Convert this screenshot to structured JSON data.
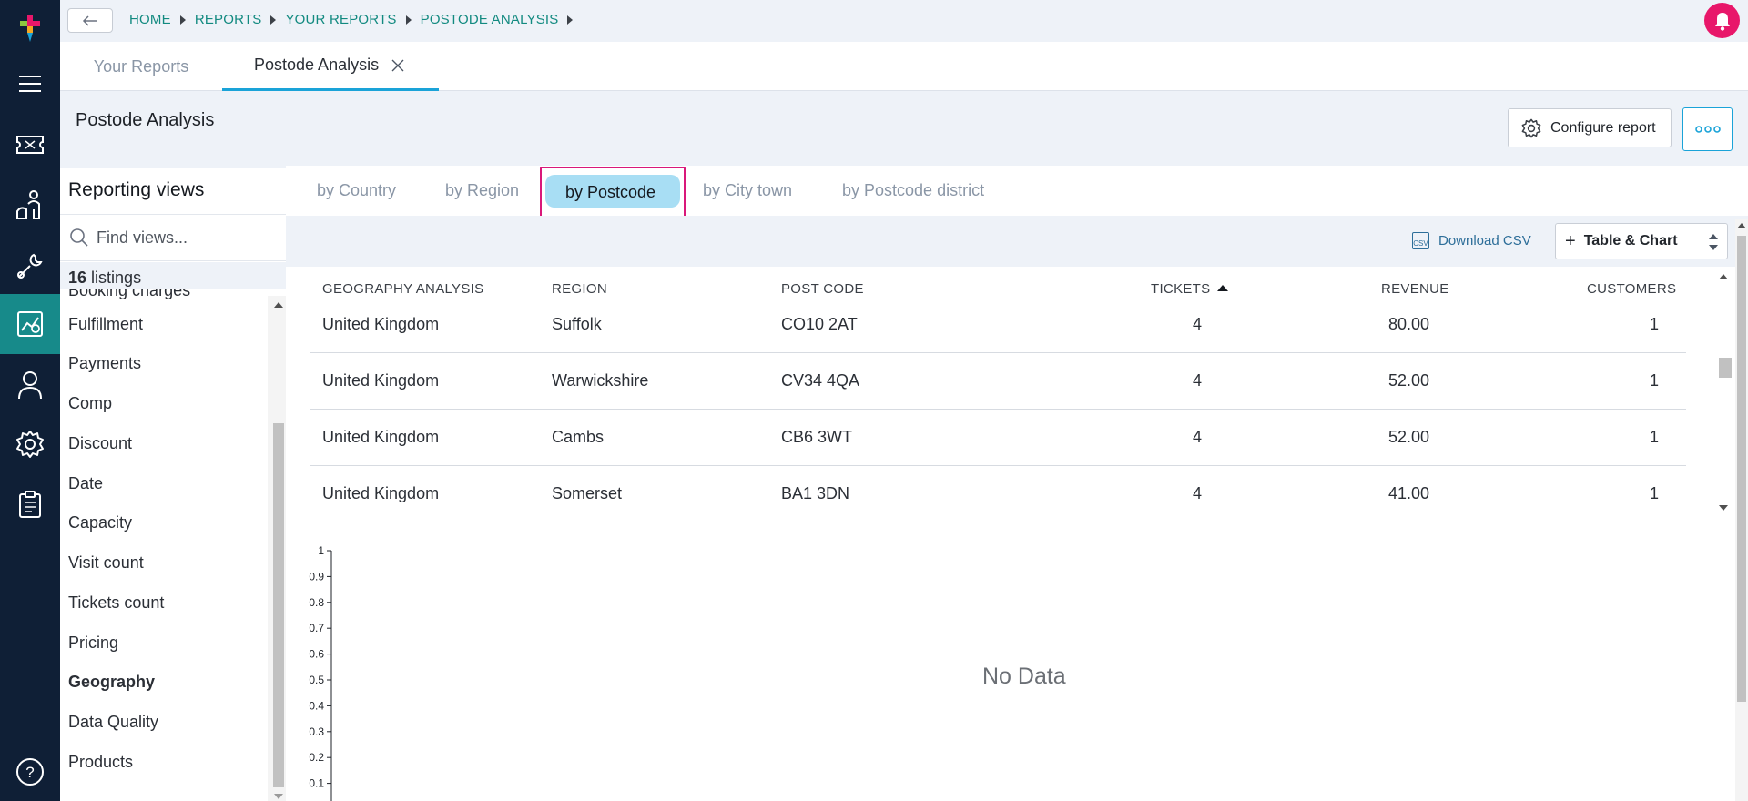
{
  "colors": {
    "rail_bg": "#0f1f36",
    "rail_active": "#178a8a",
    "accent": "#1aa3d8",
    "brand_pink": "#e8176a",
    "breadcrumb": "#128a80",
    "highlight_frame": "#d9187a"
  },
  "rail": {
    "icons": [
      "logo-icon",
      "menu-icon",
      "ticket-icon",
      "users-icon",
      "tools-icon",
      "reports-icon",
      "person-icon",
      "settings-icon",
      "clipboard-icon",
      "help-icon"
    ],
    "active": "reports-icon"
  },
  "breadcrumb": [
    "HOME",
    "REPORTS",
    "YOUR REPORTS",
    "POSTODE ANALYSIS"
  ],
  "tabs": [
    {
      "label": "Your Reports",
      "active": false
    },
    {
      "label": "Postode Analysis",
      "active": true,
      "closable": true
    }
  ],
  "page": {
    "title": "Postode Analysis",
    "configure_label": "Configure report"
  },
  "views": {
    "title": "Reporting views",
    "search_placeholder": "Find views...",
    "listings_count": "16",
    "listings_label": "listings",
    "items": [
      {
        "label": "Booking charges",
        "bold": false
      },
      {
        "label": "Fulfillment",
        "bold": false
      },
      {
        "label": "Payments",
        "bold": false
      },
      {
        "label": "Comp",
        "bold": false
      },
      {
        "label": "Discount",
        "bold": false
      },
      {
        "label": "Date",
        "bold": false
      },
      {
        "label": "Capacity",
        "bold": false
      },
      {
        "label": "Visit count",
        "bold": false
      },
      {
        "label": "Tickets count",
        "bold": false
      },
      {
        "label": "Pricing",
        "bold": false
      },
      {
        "label": "Geography",
        "bold": true
      },
      {
        "label": "Data Quality",
        "bold": false
      },
      {
        "label": "Products",
        "bold": false
      }
    ]
  },
  "subtabs": [
    {
      "label": "by Country",
      "active": false
    },
    {
      "label": "by Region",
      "active": false
    },
    {
      "label": "by Postcode",
      "active": true
    },
    {
      "label": "by City town",
      "active": false
    },
    {
      "label": "by Postcode district",
      "active": false
    }
  ],
  "actions": {
    "csv_icon_text": "CSV",
    "download_csv": "Download CSV",
    "view_mode": "Table & Chart"
  },
  "table": {
    "columns": [
      "GEOGRAPHY ANALYSIS",
      "REGION",
      "POST CODE",
      "TICKETS",
      "REVENUE",
      "CUSTOMERS"
    ],
    "sorted_column": "TICKETS",
    "sort_direction": "ascending",
    "rows": [
      [
        "United Kingdom",
        "Suffolk",
        "CO10 2AT",
        "4",
        "80.00",
        "1"
      ],
      [
        "United Kingdom",
        "Warwickshire",
        "CV34 4QA",
        "4",
        "52.00",
        "1"
      ],
      [
        "United Kingdom",
        "Cambs",
        "CB6 3WT",
        "4",
        "52.00",
        "1"
      ],
      [
        "United Kingdom",
        "Somerset",
        "BA1 3DN",
        "4",
        "41.00",
        "1"
      ]
    ]
  },
  "chart_data": {
    "type": "bar",
    "title": "",
    "xlabel": "",
    "ylabel": "",
    "ylim": [
      0,
      1
    ],
    "yticks": [
      "1",
      "0.9",
      "0.8",
      "0.7",
      "0.6",
      "0.5",
      "0.4",
      "0.3",
      "0.2",
      "0.1"
    ],
    "categories": [],
    "values": [],
    "message": "No Data"
  }
}
